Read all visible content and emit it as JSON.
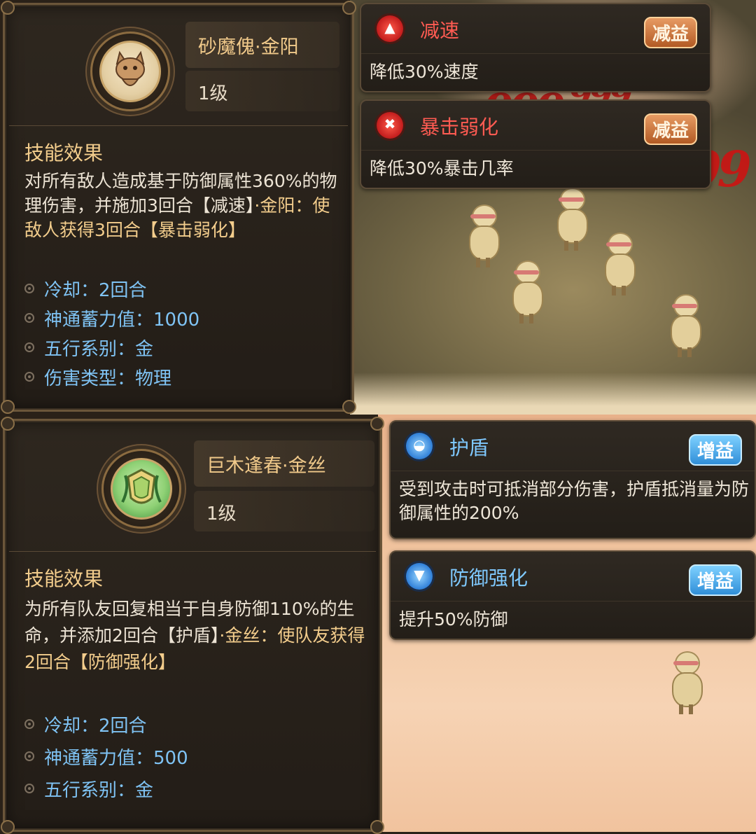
{
  "skills": [
    {
      "name": "砂魔傀·金阳",
      "level": "1级",
      "effect_heading": "技能效果",
      "effect_parts": [
        "对所有敌人造成基于防御属性360%的物理伤害，并施加3回合【减速】",
        "·金阳：",
        "使敌人获得3回合【暴击弱化】"
      ],
      "stats": [
        "冷却：2回合",
        "神通蓄力值：1000",
        "五行系别：金",
        "伤害类型：物理"
      ]
    },
    {
      "name": "巨木逢春·金丝",
      "level": "1级",
      "effect_heading": "技能效果",
      "effect_parts": [
        "为所有队友回复相当于自身防御110%的生命，并添加2回合【护盾】",
        "·金丝：",
        "使队友获得2回合【防御强化】"
      ],
      "stats": [
        "冷却：2回合",
        "神通蓄力值：500",
        "五行系别：金"
      ]
    }
  ],
  "statuses": [
    {
      "title": "减速",
      "badge": "减益",
      "desc": "降低30%速度",
      "icon": "slow-icon",
      "color": "#ff5b52"
    },
    {
      "title": "暴击弱化",
      "badge": "减益",
      "desc": "降低30%暴击几率",
      "icon": "crit-weaken-icon",
      "color": "#ff5b52"
    },
    {
      "title": "护盾",
      "badge": "增益",
      "desc": "受到攻击时可抵消部分伤害，护盾抵消量为防御属性的200%",
      "icon": "shield-icon",
      "color": "#7fc9ff"
    },
    {
      "title": "防御强化",
      "badge": "增益",
      "desc": "提升50%防御",
      "icon": "defense-up-icon",
      "color": "#7fc9ff"
    }
  ],
  "damage_numbers": [
    "999",
    "999",
    "9999",
    "99"
  ]
}
